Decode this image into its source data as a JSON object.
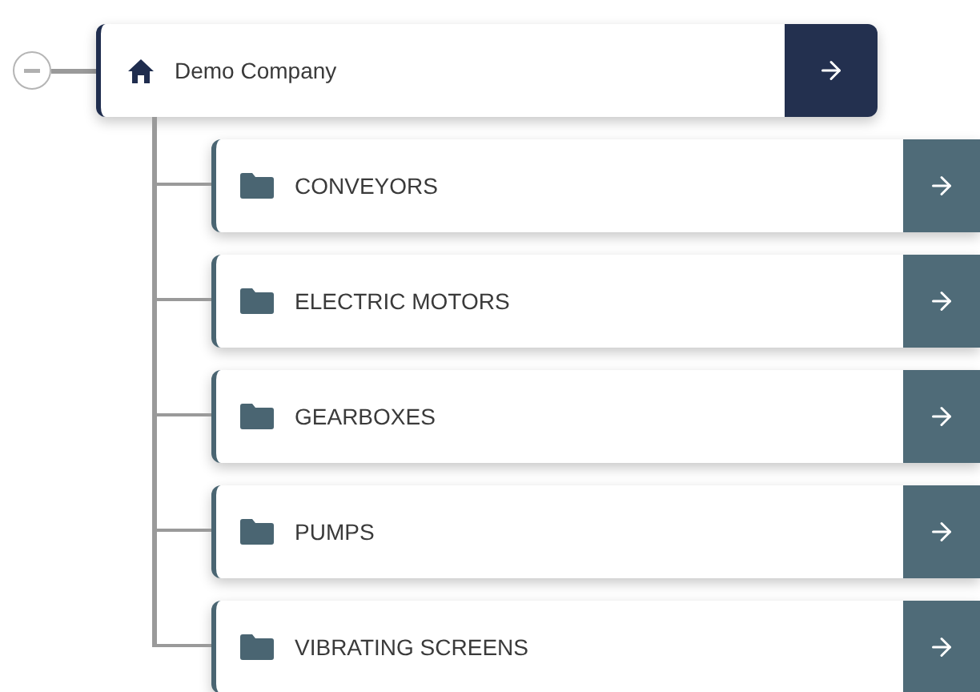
{
  "tree": {
    "label": "Demo Company",
    "expanded": true,
    "children": [
      {
        "label": "CONVEYORS"
      },
      {
        "label": "ELECTRIC MOTORS"
      },
      {
        "label": "GEARBOXES"
      },
      {
        "label": "PUMPS"
      },
      {
        "label": "VIBRATING SCREENS"
      }
    ]
  }
}
